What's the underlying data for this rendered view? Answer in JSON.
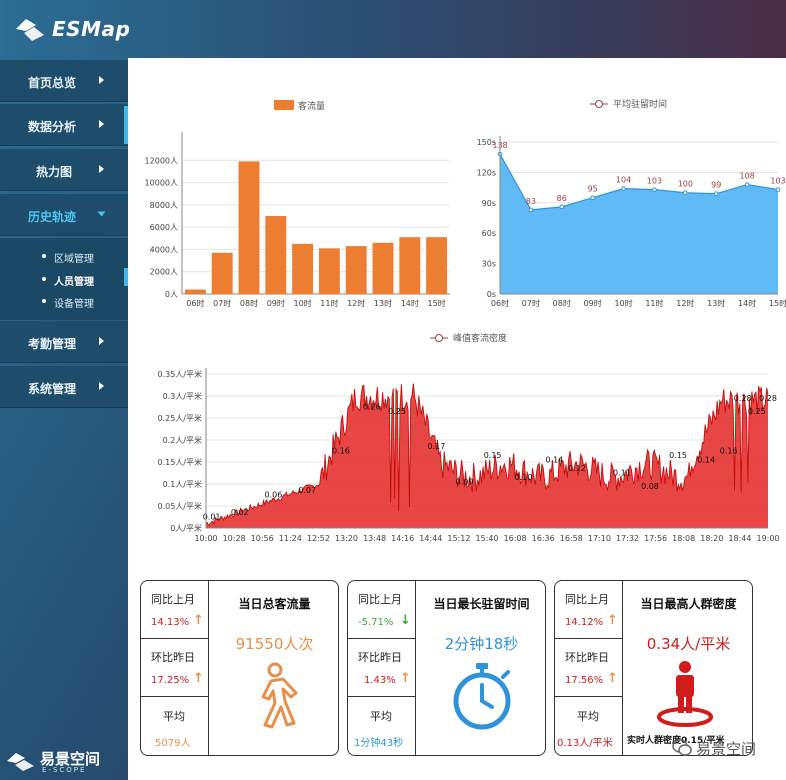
{
  "app": {
    "name": "ESMap"
  },
  "sidebar": {
    "items": [
      {
        "label": "首页总览"
      },
      {
        "label": "数据分析"
      },
      {
        "label": "热力图"
      },
      {
        "label": "历史轨迹"
      },
      {
        "label": "考勤管理"
      },
      {
        "label": "系统管理"
      }
    ],
    "sub_items": [
      {
        "label": "区域管理"
      },
      {
        "label": "人员管理"
      },
      {
        "label": "设备管理"
      }
    ]
  },
  "footer": {
    "brand_cn": "易景空间",
    "brand_en": "E-SCOPE"
  },
  "watermark": {
    "text": "易景空间"
  },
  "colors": {
    "flow": "#ed7d31",
    "stay_fill": "#56b6f4",
    "stay_line": "#2f94d6",
    "density": "#e31c1c",
    "green": "#3aa83a",
    "orange": "#e8904a",
    "blue": "#2f94d6",
    "red": "#d21c1c"
  },
  "chart_data": [
    {
      "type": "bar",
      "legend": "客流量",
      "categories": [
        "06时",
        "07时",
        "08时",
        "09时",
        "10时",
        "11时",
        "12时",
        "13时",
        "14时",
        "15时"
      ],
      "values": [
        400,
        3700,
        11900,
        7000,
        4500,
        4100,
        4300,
        4600,
        5100,
        5100
      ],
      "ylim": [
        0,
        14000
      ],
      "yticks": [
        "0人",
        "2000人",
        "4000人",
        "6000人",
        "8000人",
        "10000人",
        "12000人"
      ],
      "grid": true
    },
    {
      "type": "area",
      "legend": "平均驻留时间",
      "categories": [
        "06时",
        "07时",
        "08时",
        "09时",
        "10时",
        "11时",
        "12时",
        "13时",
        "14时",
        "15时"
      ],
      "values": [
        138,
        83,
        86,
        95,
        104,
        103,
        100,
        99,
        108,
        103
      ],
      "ylim": [
        0,
        150
      ],
      "yticks": [
        "0s",
        "30s",
        "60s",
        "90s",
        "120s",
        "150s"
      ],
      "grid": true
    },
    {
      "type": "area",
      "legend": "峰值客流密度",
      "x_labels": [
        "10:00",
        "10:28",
        "10:56",
        "11:24",
        "12:52",
        "13:20",
        "13:48",
        "14:16",
        "14:44",
        "15:12",
        "15:40",
        "16:08",
        "16:36",
        "16:58",
        "17:10",
        "17:32",
        "17:56",
        "18:08",
        "18:20",
        "18:44",
        "19:00"
      ],
      "yticks": [
        "0人/平米",
        "0.05人/平米",
        "0.1人/平米",
        "0.15人/平米",
        "0.2人/平米",
        "0.25人/平米",
        "0.3人/平米",
        "0.35人/平米"
      ],
      "ylim": [
        0,
        0.35
      ],
      "point_labels": [
        {
          "x": 0.01,
          "v": "0.01"
        },
        {
          "x": 0.06,
          "v": "0.02"
        },
        {
          "x": 0.12,
          "v": "0.06"
        },
        {
          "x": 0.18,
          "v": "0.07"
        },
        {
          "x": 0.24,
          "v": "0.16"
        },
        {
          "x": 0.295,
          "v": "0.26"
        },
        {
          "x": 0.34,
          "v": "0.25"
        },
        {
          "x": 0.41,
          "v": "0.17"
        },
        {
          "x": 0.46,
          "v": "0.09"
        },
        {
          "x": 0.51,
          "v": "0.15"
        },
        {
          "x": 0.565,
          "v": "0.10"
        },
        {
          "x": 0.62,
          "v": "0.14"
        },
        {
          "x": 0.66,
          "v": "0.12"
        },
        {
          "x": 0.74,
          "v": "0.11"
        },
        {
          "x": 0.79,
          "v": "0.08"
        },
        {
          "x": 0.84,
          "v": "0.15"
        },
        {
          "x": 0.89,
          "v": "0.14"
        },
        {
          "x": 0.93,
          "v": "0.16"
        },
        {
          "x": 0.955,
          "v": "0.28"
        },
        {
          "x": 0.98,
          "v": "0.25"
        },
        {
          "x": 1.0,
          "v": "0.28"
        }
      ]
    }
  ],
  "cards": [
    {
      "title": "当日总客流量",
      "big_value": "91550人次",
      "mom_label": "同比上月",
      "mom_value": "14.13%",
      "mom_dir": "up",
      "dod_label": "环比昨日",
      "dod_value": "17.25%",
      "dod_dir": "up",
      "avg_label": "平均",
      "avg_value": "5079人",
      "icon": "walking-person-icon"
    },
    {
      "title": "当日最长驻留时间",
      "big_value": "2分钟18秒",
      "mom_label": "同比上月",
      "mom_value": "-5.71%",
      "mom_dir": "down",
      "dod_label": "环比昨日",
      "dod_value": "1.43%",
      "dod_dir": "up",
      "avg_label": "平均",
      "avg_value": "1分钟43秒",
      "icon": "stopwatch-icon"
    },
    {
      "title": "当日最高人群密度",
      "big_value": "0.34人/平米",
      "mom_label": "同比上月",
      "mom_value": "14.12%",
      "mom_dir": "up",
      "dod_label": "环比昨日",
      "dod_value": "17.56%",
      "dod_dir": "up",
      "avg_label": "平均",
      "avg_value": "0.13人/平米",
      "icon": "person-location-icon",
      "caption": "实时人群密度0.15/平米"
    }
  ]
}
